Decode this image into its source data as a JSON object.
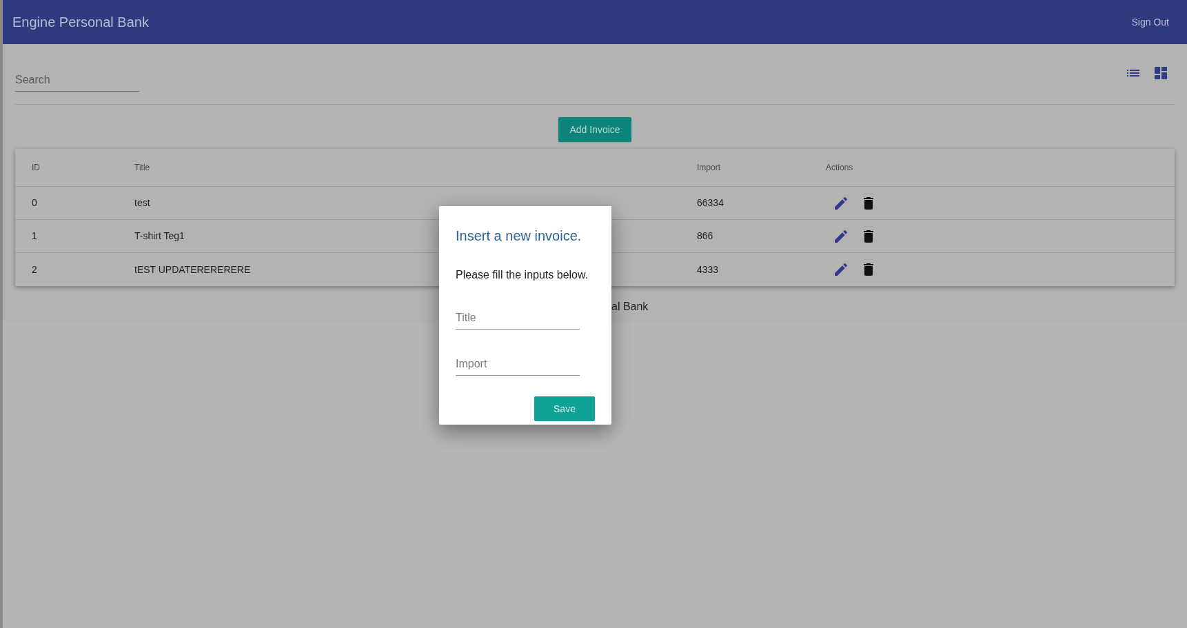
{
  "app_bar": {
    "title": "Engine Personal Bank",
    "sign_out": "Sign Out"
  },
  "search": {
    "placeholder": "Search"
  },
  "view_toggles": [
    {
      "kind": "list"
    },
    {
      "kind": "dashboard"
    }
  ],
  "add_button": "Add Invoice",
  "table": {
    "columns": [
      "ID",
      "Title",
      "Import",
      "Actions"
    ],
    "rows": [
      {
        "id": "0",
        "title": "test",
        "import": "66334"
      },
      {
        "id": "1",
        "title": "T-shirt Teg1",
        "import": "866"
      },
      {
        "id": "2",
        "title": "tEST UPDATERERERERE",
        "import": "4333"
      }
    ]
  },
  "footer": "al Bank",
  "dialog": {
    "title": "Insert a new invoice.",
    "message": "Please fill the inputs below.",
    "fields": [
      {
        "placeholder": "Title"
      },
      {
        "placeholder": "Import"
      }
    ],
    "button": "Save"
  }
}
